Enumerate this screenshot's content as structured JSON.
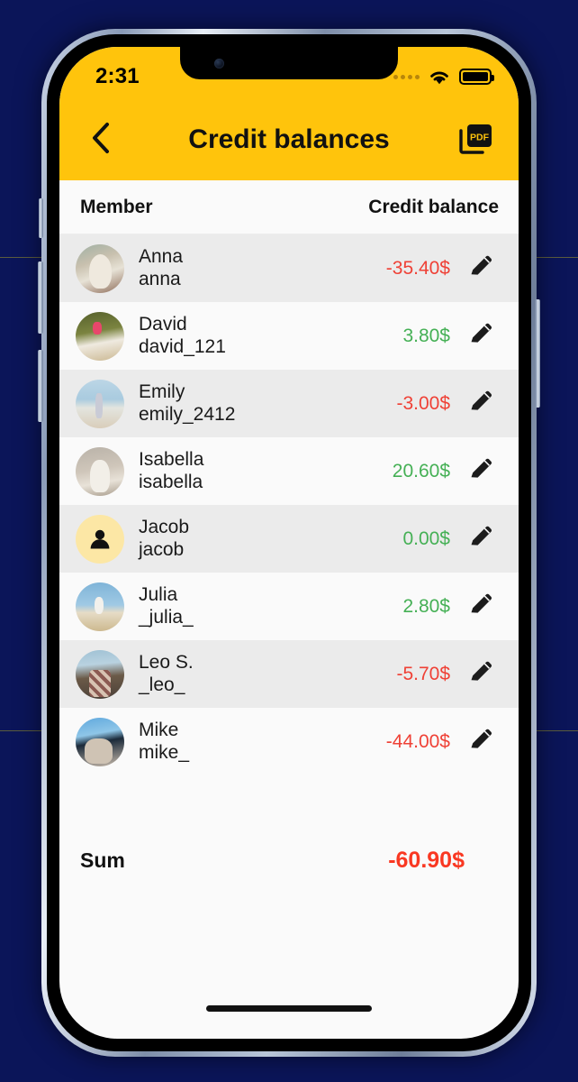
{
  "status_bar": {
    "time": "2:31",
    "signal_icon": "signal-dots-icon",
    "wifi_icon": "wifi-icon",
    "battery_icon": "battery-full-icon"
  },
  "nav": {
    "back_icon": "chevron-left-icon",
    "title": "Credit balances",
    "pdf_label": "PDF",
    "pdf_icon": "pdf-export-icon"
  },
  "theme": {
    "accent": "#FFC40C",
    "negative": "#EF4136",
    "positive": "#45B055",
    "sum_negative": "#F93822",
    "row_alt": "#EBEBEB",
    "row_plain": "#FAFAFA"
  },
  "table": {
    "columns": {
      "member": "Member",
      "balance": "Credit balance"
    },
    "rows": [
      {
        "name": "Anna",
        "username": "anna",
        "amount": "-35.40$",
        "sign": "neg",
        "avatar": "photo-anna",
        "edit_icon": "pencil-icon"
      },
      {
        "name": "David",
        "username": "david_121",
        "amount": "3.80$",
        "sign": "pos",
        "avatar": "photo-david",
        "edit_icon": "pencil-icon"
      },
      {
        "name": "Emily",
        "username": "emily_2412",
        "amount": "-3.00$",
        "sign": "neg",
        "avatar": "photo-emily",
        "edit_icon": "pencil-icon"
      },
      {
        "name": "Isabella",
        "username": "isabella",
        "amount": "20.60$",
        "sign": "pos",
        "avatar": "photo-isabella",
        "edit_icon": "pencil-icon"
      },
      {
        "name": "Jacob",
        "username": "jacob",
        "amount": "0.00$",
        "sign": "pos",
        "avatar": "placeholder-person-icon",
        "edit_icon": "pencil-icon"
      },
      {
        "name": "Julia",
        "username": "_julia_",
        "amount": "2.80$",
        "sign": "pos",
        "avatar": "photo-julia",
        "edit_icon": "pencil-icon"
      },
      {
        "name": "Leo S.",
        "username": "_leo_",
        "amount": "-5.70$",
        "sign": "neg",
        "avatar": "photo-leo",
        "edit_icon": "pencil-icon"
      },
      {
        "name": "Mike",
        "username": "mike_",
        "amount": "-44.00$",
        "sign": "neg",
        "avatar": "photo-mike",
        "edit_icon": "pencil-icon"
      }
    ]
  },
  "summary": {
    "label": "Sum",
    "value": "-60.90$"
  }
}
